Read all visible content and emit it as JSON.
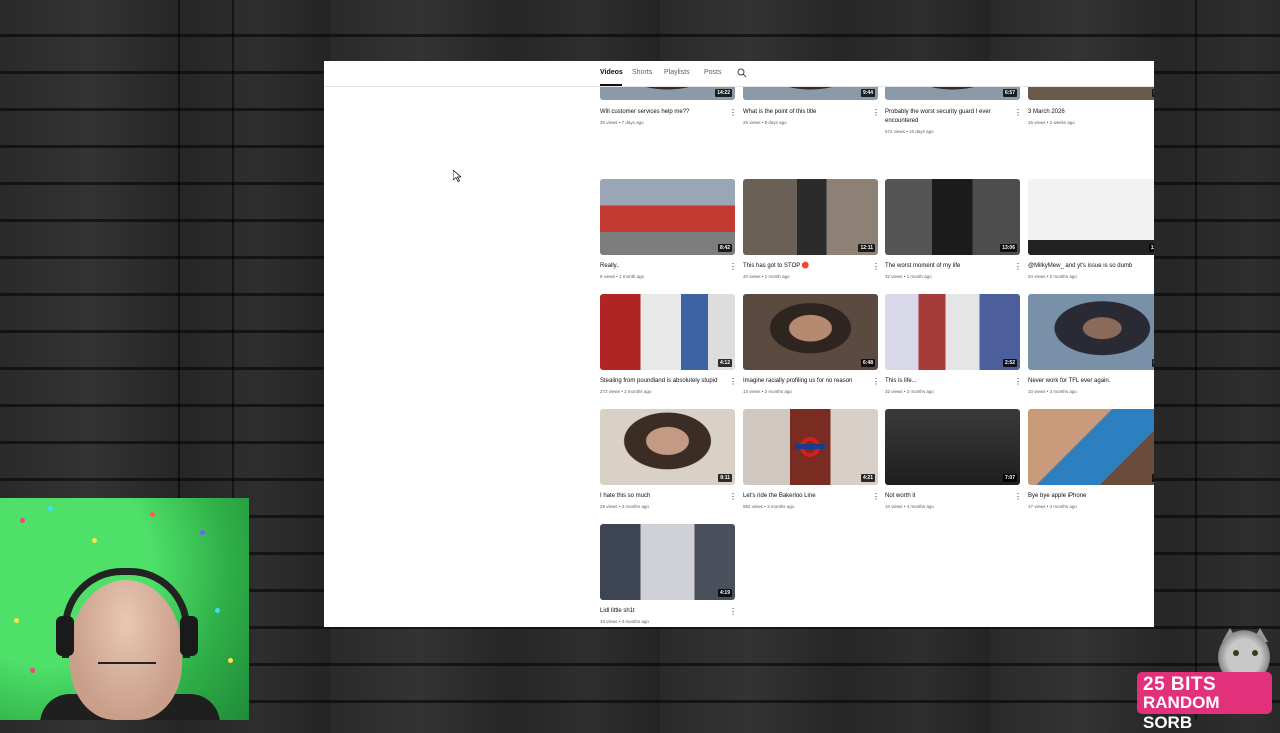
{
  "channel_tabs": [
    {
      "label": "Videos",
      "active": true
    },
    {
      "label": "Shorts",
      "active": false
    },
    {
      "label": "Playlists",
      "active": false
    },
    {
      "label": "Posts",
      "active": false
    }
  ],
  "search_icon": "search-icon",
  "videos": [
    {
      "title": "Will customer services help me??",
      "title2": "",
      "meta": "30 views • 7 days ago",
      "duration": "14:22",
      "thumb": "t-face"
    },
    {
      "title": "What is the point of this title",
      "title2": "",
      "meta": "25 views • 8 days ago",
      "duration": "9:44",
      "thumb": "t-face"
    },
    {
      "title": "Probably the worst security guard I ever",
      "title2": "encountered",
      "meta": "672 views • 10 days ago",
      "duration": "6:57",
      "thumb": "t-face"
    },
    {
      "title": "3 March 2026",
      "title2": "",
      "meta": "16 views • 2 weeks ago",
      "duration": "5:",
      "thumb": "t-street"
    },
    {
      "title": "Really..",
      "title2": "",
      "meta": "8 views • 1 month ago",
      "duration": "8:42",
      "thumb": "t-bus"
    },
    {
      "title": "This has got to STOP 🛑",
      "title2": "",
      "meta": "40 views • 1 month ago",
      "duration": "12:11",
      "thumb": "t-man"
    },
    {
      "title": "The worst moment of my life",
      "title2": "",
      "meta": "32 views • 1 month ago",
      "duration": "13:06",
      "thumb": "t-guard"
    },
    {
      "title": "@MilkyMew_ and yt's issue is so dumb",
      "title2": "",
      "meta": "34 views • 2 months ago",
      "duration": "12:",
      "thumb": "t-doc"
    },
    {
      "title": "Stealing from poundland is absolutely stupid",
      "title2": "",
      "meta": "273 views • 2 months ago",
      "duration": "4:12",
      "thumb": "t-shop"
    },
    {
      "title": "Imagine racially profiling us for no reason",
      "title2": "",
      "meta": "13 views • 2 months ago",
      "duration": "6:48",
      "thumb": "t-curly"
    },
    {
      "title": "This is life...",
      "title2": "",
      "meta": "32 views • 2 months ago",
      "duration": "2:52",
      "thumb": "t-store2"
    },
    {
      "title": "Never work for TFL ever again.",
      "title2": "",
      "meta": "10 views • 3 months ago",
      "duration": "6:",
      "thumb": "t-hood"
    },
    {
      "title": "I hate this so much",
      "title2": "",
      "meta": "25 views • 3 months ago",
      "duration": "8:11",
      "thumb": "t-curly2"
    },
    {
      "title": "Let's ride the Bakerloo Line",
      "title2": "",
      "meta": "582 views • 3 months ago",
      "duration": "4:21",
      "thumb": "t-tube"
    },
    {
      "title": "Not worth it",
      "title2": "",
      "meta": "10 views • 4 months ago",
      "duration": "7:07",
      "thumb": "t-phone-dark"
    },
    {
      "title": "Bye bye apple iPhone",
      "title2": "",
      "meta": "47 views • 4 months ago",
      "duration": "3:",
      "thumb": "t-ipad"
    },
    {
      "title": "Lidl little sh1t",
      "title2": "",
      "meta": "33 views • 4 months ago",
      "duration": "4:19",
      "thumb": "t-bag"
    }
  ],
  "brand": {
    "line1": "25 BITS",
    "line2": "RANDOM SORB",
    "color": "#e2307b"
  }
}
